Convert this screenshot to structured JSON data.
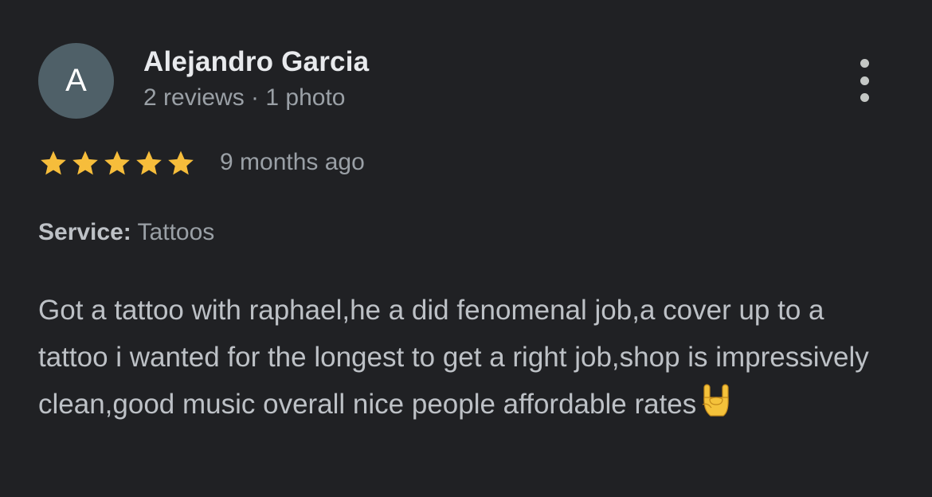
{
  "review": {
    "avatar_letter": "A",
    "author_name": "Alejandro Garcia",
    "author_meta": "2 reviews · 1 photo",
    "rating": 5,
    "rating_max": 5,
    "time_ago": "9 months ago",
    "service_label": "Service:",
    "service_value": "Tattoos",
    "text": "Got a tattoo with raphael,he a did fenomenal job,a cover up to a tattoo i wanted for the longest to get a right job,shop is impressively clean,good music overall nice people affordable rates",
    "trailing_emoji": "sign-of-the-horns"
  },
  "colors": {
    "background": "#202124",
    "star": "#f6bd3b",
    "avatar_bg": "#4f6068",
    "primary_text": "#e8eaed",
    "secondary_text": "#9aa0a6"
  },
  "icons": {
    "more": "more-vert-icon",
    "star": "star-icon"
  }
}
